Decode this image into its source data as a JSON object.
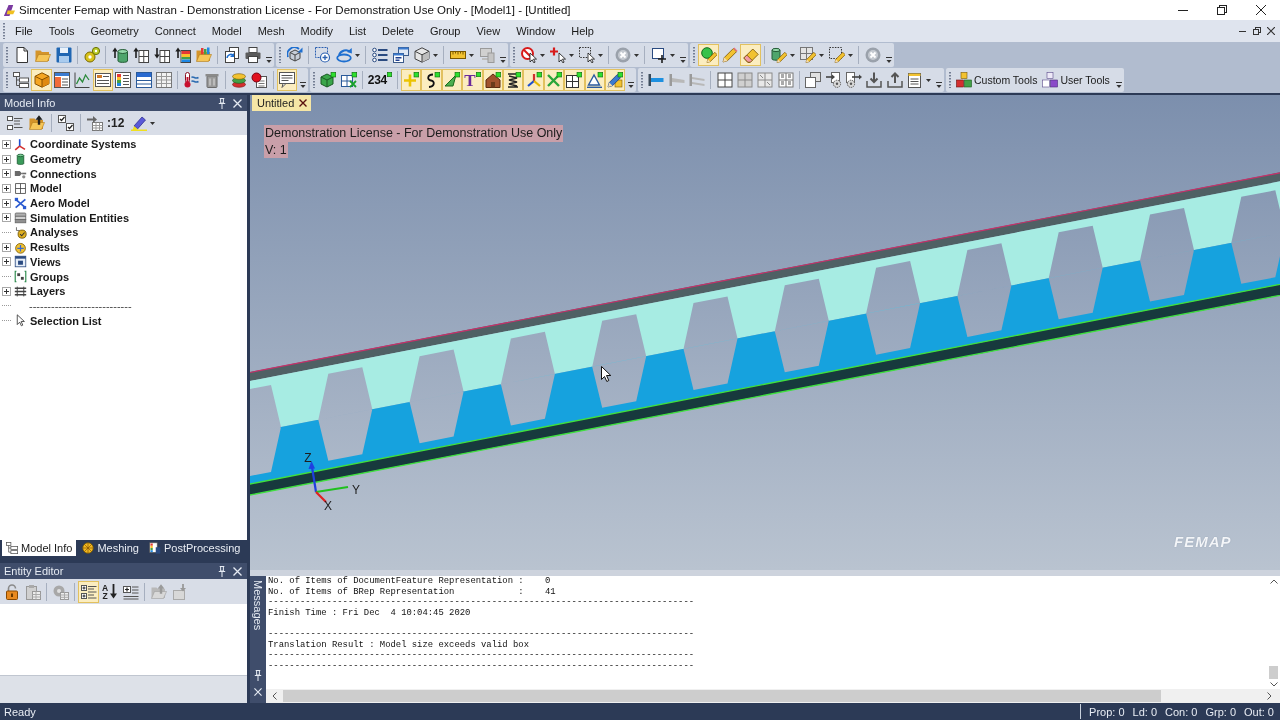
{
  "window": {
    "title": "Simcenter Femap with Nastran - Demonstration License - For Demonstration Use Only - [Model1] - [Untitled]"
  },
  "menu_bar": [
    "File",
    "Tools",
    "Geometry",
    "Connect",
    "Model",
    "Mesh",
    "Modify",
    "List",
    "Delete",
    "Group",
    "View",
    "Window",
    "Help"
  ],
  "toolbars": {
    "row_1": [
      [
        {
          "on": false
        },
        {
          "on": false
        },
        {
          "on": false
        },
        {
          "on": false
        },
        {
          "on": false
        },
        {
          "on": false
        },
        {
          "on": false
        },
        {
          "on": false
        },
        {
          "on": false
        },
        {
          "on": false
        },
        {
          "on": false
        }
      ],
      [
        {
          "on": false
        },
        {
          "on": false
        },
        {
          "on": false
        },
        {
          "on": false
        },
        {
          "on": false
        },
        {
          "on": false
        },
        {
          "on": false
        },
        {
          "on": false
        }
      ],
      [
        {
          "on": false
        },
        {
          "on": false
        },
        {
          "on": false
        },
        {
          "on": false
        },
        {
          "on": false
        }
      ],
      [
        {
          "on": true
        },
        {
          "on": false
        },
        {
          "on": true
        },
        {
          "on": false
        },
        {
          "on": false
        },
        {
          "on": false
        },
        {
          "on": false
        }
      ]
    ],
    "row_2": [
      [
        {
          "on": false
        },
        {
          "on": true
        },
        {
          "on": false
        },
        {
          "on": false
        },
        {
          "on": true
        },
        {
          "on": false
        },
        {
          "on": false
        },
        {
          "on": false
        },
        {
          "on": false
        },
        {
          "on": false
        },
        {
          "on": false
        },
        {
          "on": false
        },
        {
          "on": true
        }
      ],
      [
        {
          "on": false
        },
        {
          "on": false
        },
        {
          "label": "234",
          "on": false
        },
        {
          "on": true
        },
        {
          "on": true
        },
        {
          "on": true
        },
        {
          "label": "T",
          "on": true
        },
        {
          "on": true
        },
        {
          "on": true
        },
        {
          "on": true
        },
        {
          "on": true
        },
        {
          "on": true
        },
        {
          "on": true
        },
        {
          "on": true
        }
      ],
      [
        {
          "on": false
        },
        {
          "on": false
        },
        {
          "on": false
        },
        {
          "on": false
        },
        {
          "on": false
        },
        {
          "on": false
        },
        {
          "on": false
        },
        {
          "on": false
        },
        {
          "on": false
        },
        {
          "on": false
        },
        {
          "on": false
        },
        {
          "on": false
        },
        {
          "on": false
        }
      ],
      [
        {
          "label": "Custom Tools",
          "on": false
        },
        {
          "label": "User Tools",
          "on": false
        }
      ]
    ]
  },
  "model_info_panel": {
    "title": "Model Info",
    "count_label": ":12",
    "tree": [
      {
        "label": "Coordinate Systems",
        "kind": "node",
        "expanded": false
      },
      {
        "label": "Geometry",
        "kind": "node",
        "expanded": false
      },
      {
        "label": "Connections",
        "kind": "node",
        "expanded": false
      },
      {
        "label": "Model",
        "kind": "node",
        "expanded": false
      },
      {
        "label": "Aero Model",
        "kind": "node",
        "expanded": false
      },
      {
        "label": "Simulation Entities",
        "kind": "node",
        "expanded": false
      },
      {
        "label": "Analyses",
        "kind": "leaf"
      },
      {
        "label": "Results",
        "kind": "node",
        "expanded": false
      },
      {
        "label": "Views",
        "kind": "node",
        "expanded": false
      },
      {
        "label": "Groups",
        "kind": "leaf"
      },
      {
        "label": "Layers",
        "kind": "node",
        "expanded": false
      },
      {
        "label": "----------------------------",
        "kind": "separator"
      },
      {
        "label": "Selection List",
        "kind": "leaf"
      }
    ],
    "tabs": [
      {
        "label": "Model Info",
        "selected": true
      },
      {
        "label": "Meshing",
        "selected": false
      },
      {
        "label": "PostProcessing",
        "selected": false
      }
    ]
  },
  "entity_editor": {
    "title": "Entity Editor",
    "toolbar": [
      {
        "on": false
      },
      {
        "on": false
      },
      {
        "on": false
      },
      {
        "on": true
      },
      {
        "label": "AZ",
        "on": false
      },
      {
        "on": false
      },
      {
        "on": false
      },
      {
        "on": false
      }
    ]
  },
  "viewport": {
    "tabs": [
      {
        "label": "Untitled",
        "selected": true
      }
    ],
    "overlay_lines": [
      "Demonstration License - For Demonstration Use Only",
      "V: 1"
    ],
    "triad_labels": [
      "Z",
      "Y",
      "X"
    ],
    "logo": "FEMAP"
  },
  "messages_panel": {
    "title": "Messages",
    "blocks": [
      {
        "lines": [
          "No. of Items of DocumentFeature Representation :    0",
          "No. of Items of BRep Representation            :    41",
          "--------------------------------------------------------------------------------",
          "Finish Time : Fri Dec  4 10:04:45 2020"
        ]
      },
      {
        "lines": [
          "--------------------------------------------------------------------------------",
          "Translation Result : Model size exceeds valid box",
          "--------------------------------------------------------------------------------",
          "--------------------------------------------------------------------------------"
        ]
      }
    ]
  },
  "status_bar": {
    "text": "Ready",
    "counters": [
      "Prop: 0",
      "Ld: 0",
      "Con: 0",
      "Grp: 0",
      "Out: 0"
    ]
  }
}
